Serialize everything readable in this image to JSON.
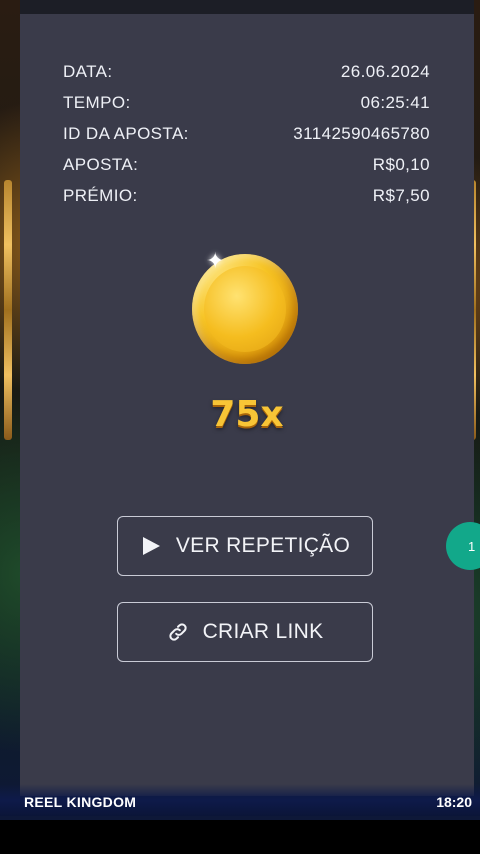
{
  "details": [
    {
      "label": "DATA:",
      "value": "26.06.2024"
    },
    {
      "label": "TEMPO:",
      "value": "06:25:41"
    },
    {
      "label": "ID DA APOSTA:",
      "value": "31142590465780"
    },
    {
      "label": "APOSTA:",
      "value": "R$0,10"
    },
    {
      "label": "PRÉMIO:",
      "value": "R$7,50"
    }
  ],
  "result": {
    "icon": "gold-coin-icon",
    "multiplier": "75x"
  },
  "buttons": {
    "replay_label": "VER REPETIÇÃO",
    "replay_icon": "play-icon",
    "link_label": "CRIAR LINK",
    "link_icon": "link-icon"
  },
  "badge": {
    "text": "1"
  },
  "footer": {
    "brand": "REEL KINGDOM",
    "time": "18:20"
  },
  "colors": {
    "panel": "#3a3b4a",
    "accent_gold": "#f8c536",
    "badge": "#12a88a"
  }
}
